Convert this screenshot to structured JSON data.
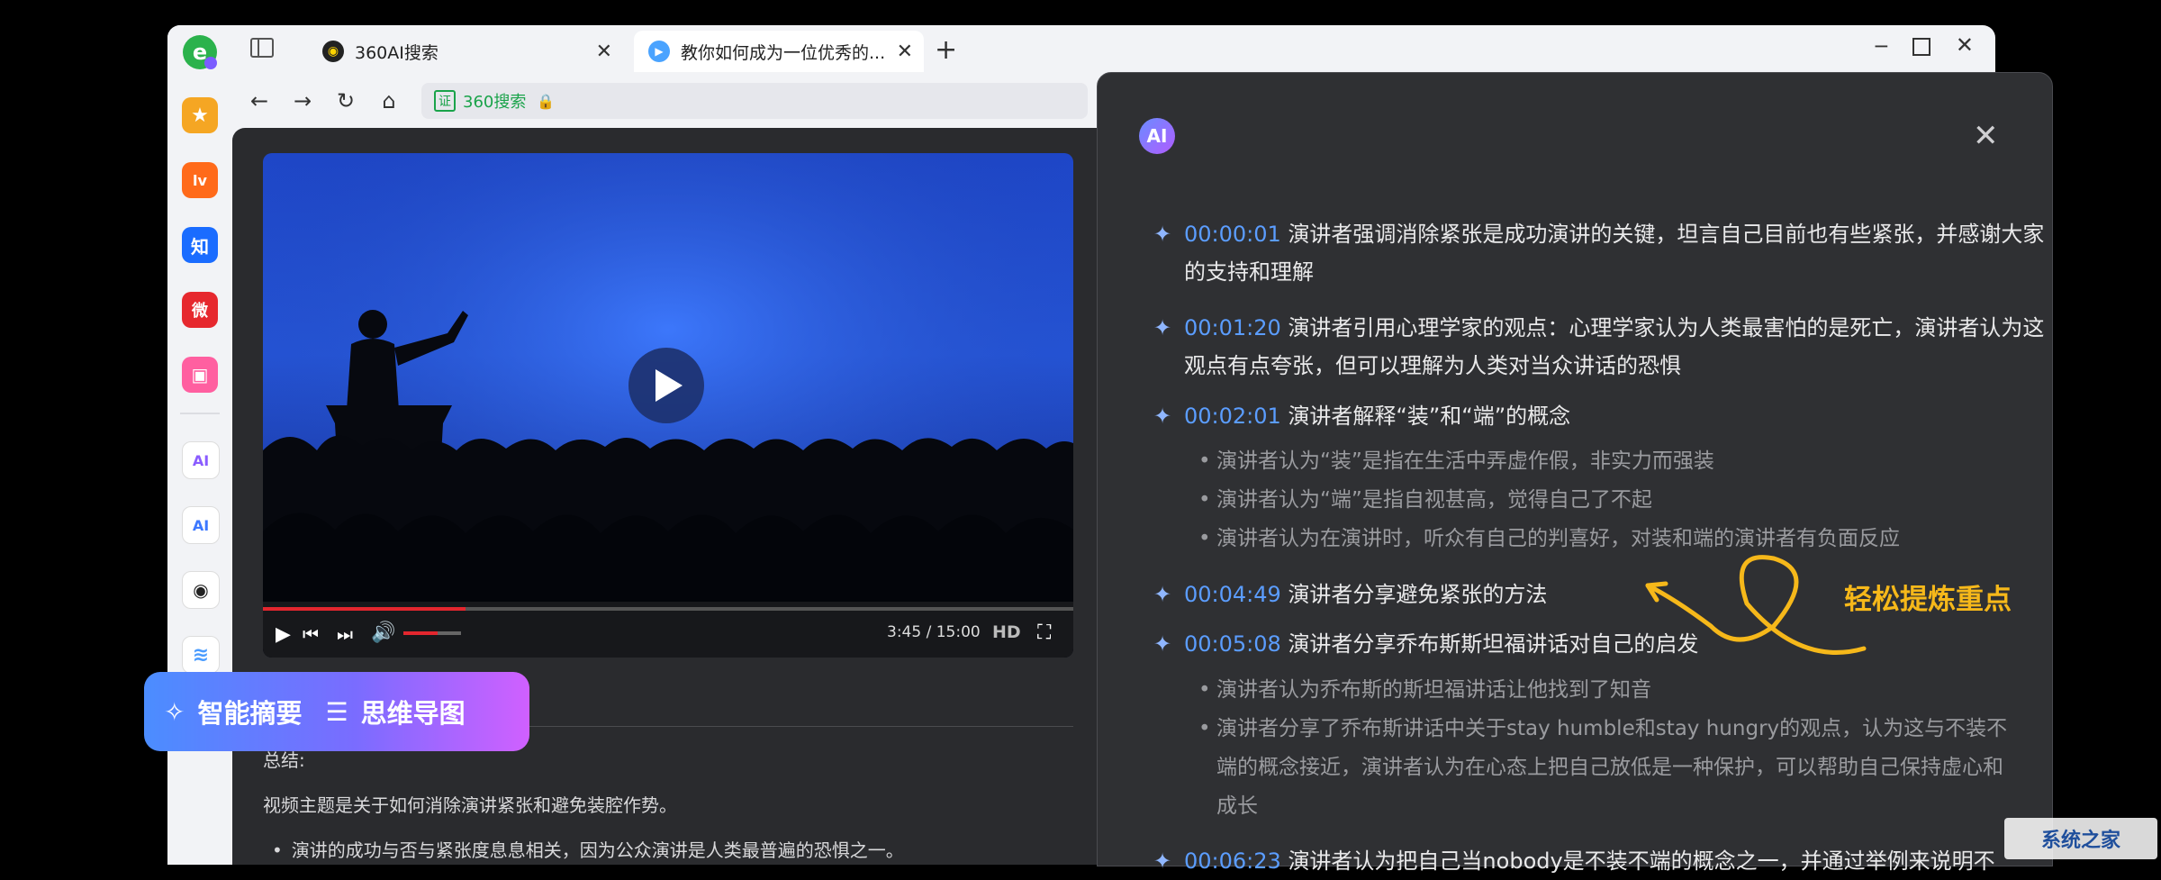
{
  "tabs": [
    {
      "label": "360AI搜索"
    },
    {
      "label": "教你如何成为一位优秀的..."
    }
  ],
  "address": {
    "site_label": "360搜索"
  },
  "rail": [
    {
      "icon": "star-icon",
      "color": "#f5a623",
      "glyph": "★"
    },
    {
      "icon": "video-app-icon",
      "color": "#ff6a1a",
      "glyph": "lv"
    },
    {
      "icon": "zhihu-icon",
      "color": "#1a6cff",
      "glyph": "知"
    },
    {
      "icon": "weibo-icon",
      "color": "#e6282e",
      "glyph": "微"
    },
    {
      "icon": "bilibili-icon",
      "color": "#ff5fa0",
      "glyph": "▣"
    },
    {
      "icon": "ai-add-icon",
      "color": "#8a5cff",
      "glyph": "AI"
    },
    {
      "icon": "ai-icon",
      "color": "#3c78ff",
      "glyph": "AI"
    },
    {
      "icon": "chat-bot-icon",
      "color": "#ffd400",
      "glyph": "◉"
    },
    {
      "icon": "layers-icon",
      "color": "#4a9cff",
      "glyph": "≋"
    }
  ],
  "video": {
    "time": "3:45 / 15:00",
    "quality": "HD",
    "progress": 0.25,
    "volume": 0.6
  },
  "pill": {
    "summary": "智能摘要",
    "mindmap": "思维导图"
  },
  "page_text": {
    "summary_label": "总结:",
    "topic": "视频主题是关于如何消除演讲紧张和避免装腔作势。",
    "bullet1": "演讲的成功与否与紧张度息息相关，因为公众演讲是人类最普遍的恐惧之一。"
  },
  "panel": {
    "ai_badge": "AI",
    "entries": [
      {
        "ts": "00:00:01",
        "text": "演讲者强调消除紧张是成功演讲的关键，坦言自己目前也有些紧张，并感谢大家的支持和理解"
      },
      {
        "ts": "00:01:20",
        "text": "演讲者引用心理学家的观点：心理学家认为人类最害怕的是死亡，演讲者认为这观点有点夸张，但可以理解为人类对当众讲话的恐惧"
      },
      {
        "ts": "00:02:01",
        "text": "演讲者解释“装”和“端”的概念"
      },
      {
        "ts": "00:04:49",
        "text": "演讲者分享避免紧张的方法"
      },
      {
        "ts": "00:05:08",
        "text": "演讲者分享乔布斯斯坦福讲话对自己的启发"
      },
      {
        "ts": "00:06:23",
        "text": "演讲者认为把自己当nobody是不装不端的概念之一，并通过举例来说明不"
      }
    ],
    "bullets_a": [
      "演讲者认为“装”是指在生活中弄虚作假，非实力而强装",
      "演讲者认为“端”是指自视甚高，觉得自己了不起",
      "演讲者认为在演讲时，听众有自己的判喜好，对装和端的演讲者有负面反应"
    ],
    "bullets_b": [
      "演讲者认为乔布斯的斯坦福讲话让他找到了知音",
      "演讲者分享了乔布斯讲话中关于stay humble和stay hungry的观点，认为这与不装不端的概念接近，演讲者认为在心态上把自己放低是一种保护，可以帮助自己保持虚心和成长"
    ],
    "callout": "轻松提炼重点"
  },
  "watermark": "系统之家"
}
